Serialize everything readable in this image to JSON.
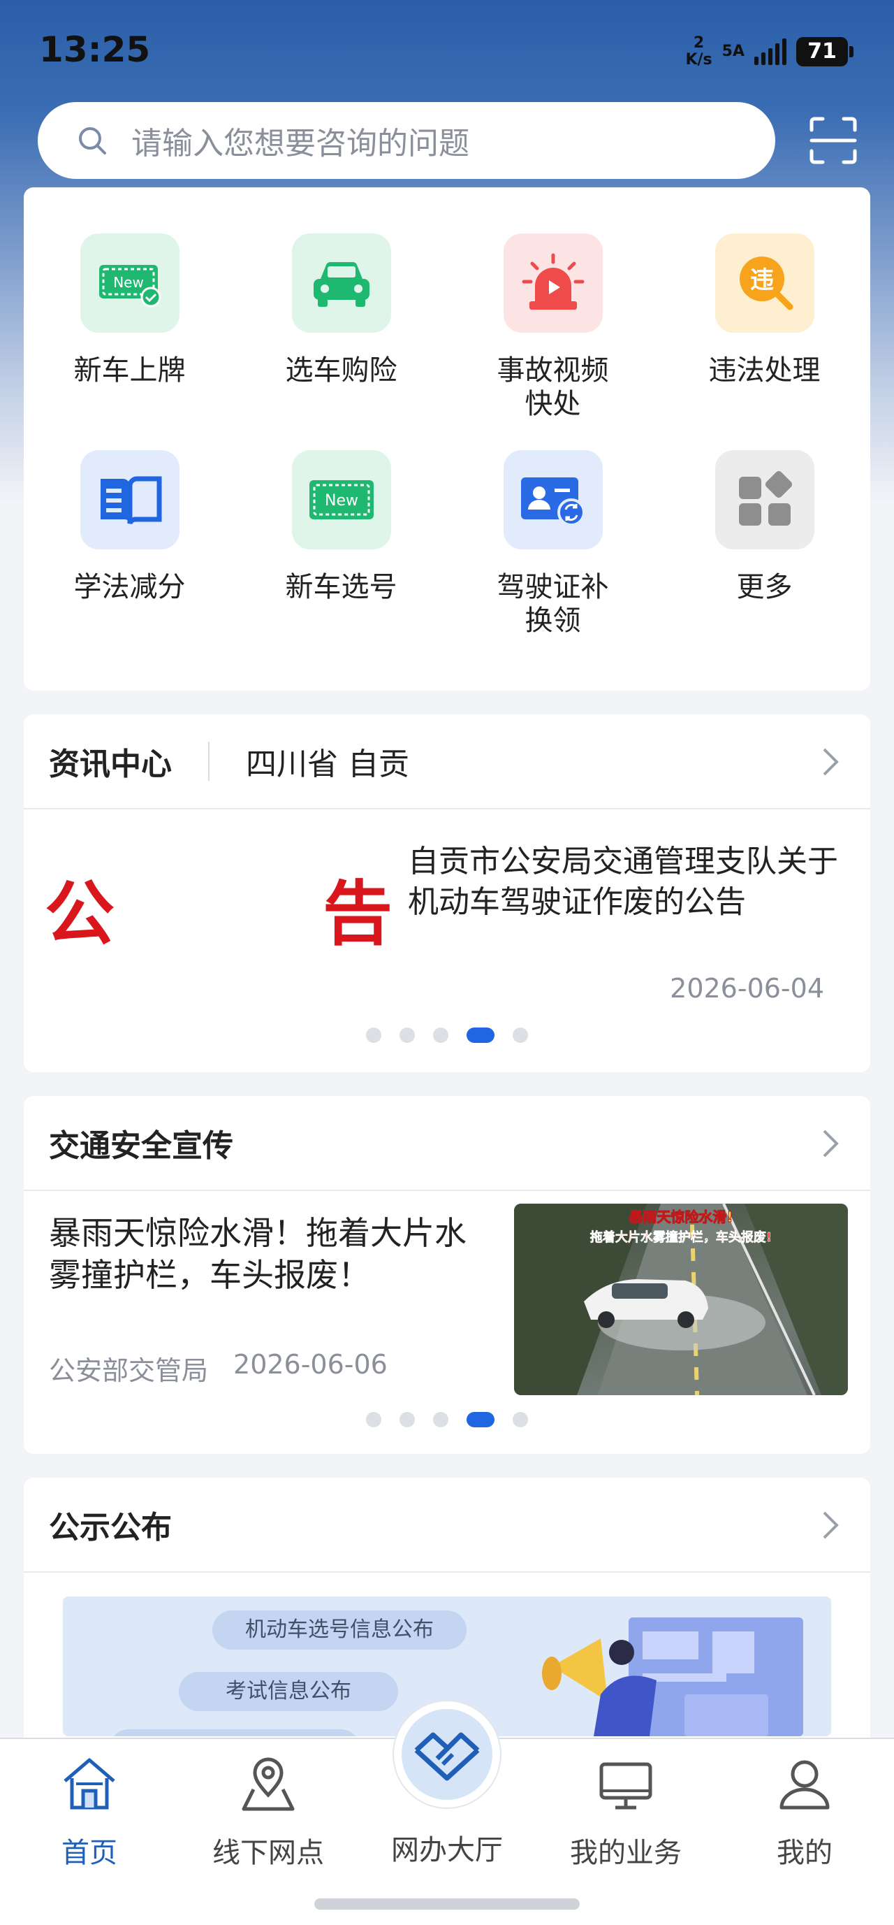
{
  "status_bar": {
    "time": "13:25",
    "net_speed_value": "2",
    "net_speed_unit": "K/s",
    "signal_label": "5A",
    "battery": "71"
  },
  "search": {
    "placeholder": "请输入您想要咨询的问题"
  },
  "quick_services": [
    {
      "label": "新车上牌",
      "icon": "new-plate-icon",
      "bg": "#dff5ea"
    },
    {
      "label": "选车购险",
      "icon": "car-icon",
      "bg": "#dff5ea"
    },
    {
      "label": "事故视频快处",
      "icon": "alarm-video-icon",
      "bg": "#fde4e4"
    },
    {
      "label": "违法处理",
      "icon": "violation-icon",
      "bg": "#fdefcf"
    },
    {
      "label": "学法减分",
      "icon": "book-icon",
      "bg": "#e2ebfb"
    },
    {
      "label": "新车选号",
      "icon": "plate-number-icon",
      "bg": "#dff5ea"
    },
    {
      "label": "驾驶证补换领",
      "icon": "license-renew-icon",
      "bg": "#e2ebfb"
    },
    {
      "label": "更多",
      "icon": "more-grid-icon",
      "bg": "#ececec"
    }
  ],
  "news": {
    "title": "资讯中心",
    "region": "四川省 自贡",
    "item_title": "自贡市公安局交通管理支队关于机动车驾驶证作废的公告",
    "item_date": "2026-06-04",
    "notice_chars": [
      "公",
      "告"
    ],
    "carousel_pages": 5,
    "carousel_active": 4
  },
  "safety": {
    "title": "交通安全宣传",
    "item_title": "暴雨天惊险水滑！拖着大片水雾撞护栏，车头报废！",
    "source": "公安部交管局",
    "date": "2026-06-06",
    "image_caption_1": "暴雨天惊险水滑!",
    "image_caption_2": "拖着大片水雾撞护栏，车头报废!",
    "carousel_pages": 5,
    "carousel_active": 4
  },
  "publicity": {
    "title": "公示公布",
    "pills": [
      "机动车选号信息公布",
      "考试信息公布"
    ]
  },
  "bottom_nav": [
    {
      "label": "首页",
      "icon": "home-icon",
      "active": true
    },
    {
      "label": "线下网点",
      "icon": "location-icon",
      "active": false
    },
    {
      "label": "网办大厅",
      "icon": "handshake-icon",
      "active": false
    },
    {
      "label": "我的业务",
      "icon": "monitor-icon",
      "active": false
    },
    {
      "label": "我的",
      "icon": "user-icon",
      "active": false
    }
  ],
  "colors": {
    "accent": "#1f66e0",
    "nav_active": "#1f5fb8",
    "header_blue": "#2a5fa8"
  }
}
